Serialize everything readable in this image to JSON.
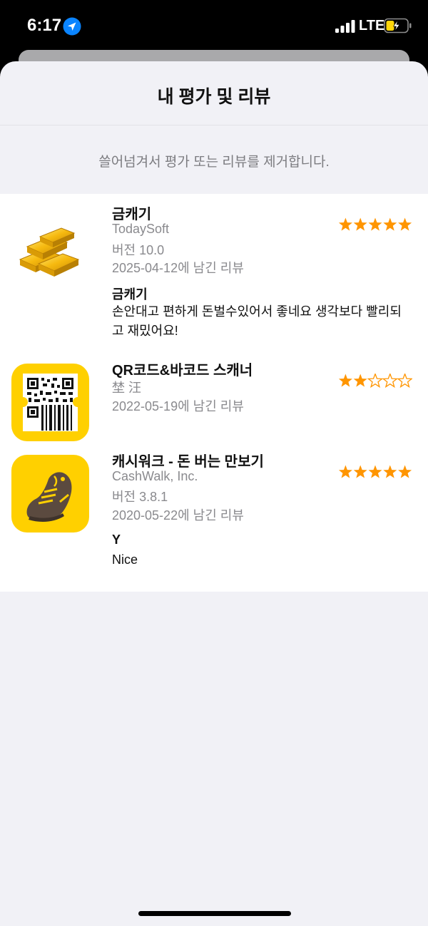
{
  "status_bar": {
    "time": "6:17",
    "network": "LTE"
  },
  "sheet": {
    "title": "내 평가 및 리뷰",
    "hint": "쓸어넘겨서 평가 또는 리뷰를 제거합니다."
  },
  "reviews": [
    {
      "app_name": "금캐기",
      "developer": "TodaySoft",
      "version": "버전 10.0",
      "date": "2025-04-12에 남긴 리뷰",
      "rating": 5,
      "review_title": "금캐기",
      "review_body": "손안대고 편하게 돈벌수있어서 좋네요 생각보다 빨리되고 재밌어요!",
      "icon": "gold-bars-icon"
    },
    {
      "app_name": "QR코드&바코드 스캐너",
      "developer": "埜 汪",
      "date": "2022-05-19에 남긴 리뷰",
      "rating": 2,
      "icon": "qr-barcode-icon"
    },
    {
      "app_name": "캐시워크 - 돈 버는 만보기",
      "developer": "CashWalk, Inc.",
      "version": "버전 3.8.1",
      "date": "2020-05-22에 남긴 리뷰",
      "rating": 5,
      "review_title": "Y",
      "review_body": "Nice",
      "icon": "sneaker-icon"
    }
  ],
  "colors": {
    "star": "#ff9500",
    "icon_yellow": "#ffd000",
    "sheet_bg": "#f1f1f6"
  }
}
